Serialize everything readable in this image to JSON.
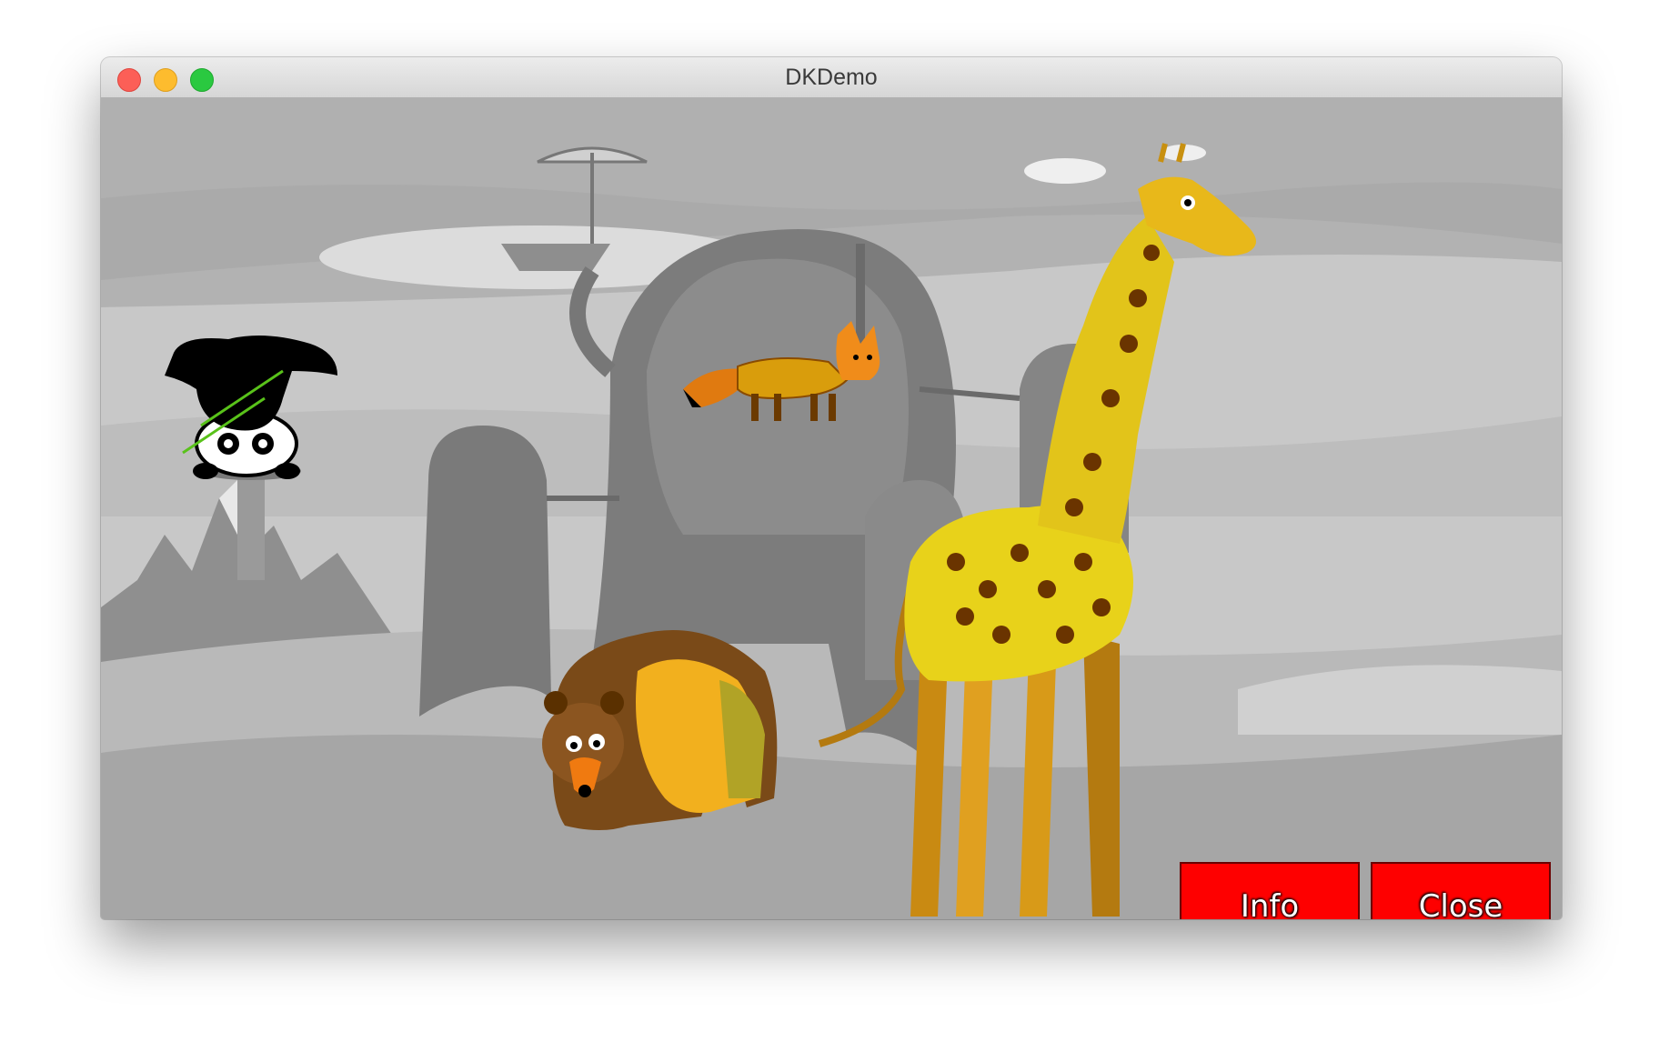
{
  "window": {
    "title": "DKDemo"
  },
  "buttons": {
    "info_label": "Info",
    "close_label": "Close"
  },
  "colors": {
    "button_bg": "#fe0000",
    "button_text": "#ffffff",
    "close_light": "#fc5f57",
    "minimize_light": "#fdbc2e",
    "zoom_light": "#2ac940"
  },
  "sprites": [
    "panda",
    "fox",
    "bear",
    "giraffe"
  ]
}
